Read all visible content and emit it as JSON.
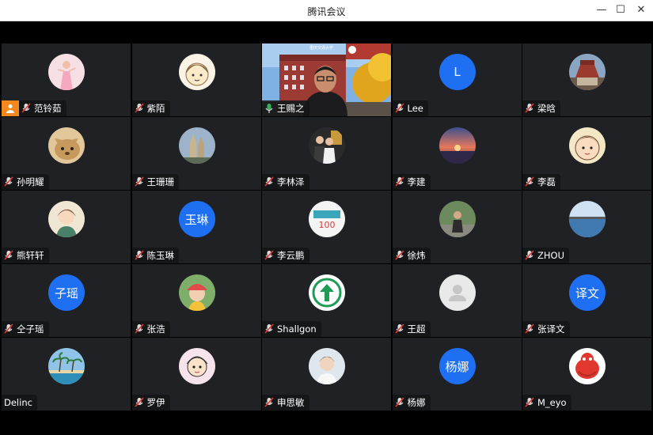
{
  "window": {
    "title": "腾讯会议",
    "controls": [
      "—",
      "☐",
      "✕"
    ]
  },
  "video_tile": {
    "banner_text": "重庆交通大学"
  },
  "participants": [
    {
      "name": "范铃茹",
      "avatar": "photo-girl-pink",
      "mic": "muted"
    },
    {
      "name": "紫陌",
      "avatar": "cartoon-girl",
      "mic": "muted"
    },
    {
      "name": "王赐之",
      "avatar": "live-video",
      "mic": "speaking"
    },
    {
      "name": "Lee",
      "avatar_text": "L",
      "mic": "muted"
    },
    {
      "name": "梁晗",
      "avatar": "photo-building",
      "mic": "muted"
    },
    {
      "name": "孙明耀",
      "avatar": "photo-animal",
      "mic": "muted"
    },
    {
      "name": "王珊珊",
      "avatar": "photo-cathedral",
      "mic": "muted"
    },
    {
      "name": "李林泽",
      "avatar": "photo-group",
      "mic": "muted"
    },
    {
      "name": "李建",
      "avatar": "photo-sunset",
      "mic": "muted"
    },
    {
      "name": "李磊",
      "avatar": "cartoon-face",
      "mic": "muted"
    },
    {
      "name": "熊轩轩",
      "avatar": "drawing-girl",
      "mic": "muted"
    },
    {
      "name": "陈玉琳",
      "avatar_text": "玉琳",
      "mic": "muted"
    },
    {
      "name": "李云鹏",
      "avatar": "logo-100",
      "mic": "muted"
    },
    {
      "name": "徐炜",
      "avatar": "photo-person",
      "mic": "muted"
    },
    {
      "name": "ZHOU",
      "avatar": "photo-lake",
      "mic": "muted"
    },
    {
      "name": "仝子瑶",
      "avatar_text": "子瑶",
      "mic": "muted"
    },
    {
      "name": "张浩",
      "avatar": "photo-kid",
      "mic": "muted"
    },
    {
      "name": "Shallgon",
      "avatar": "arrow-up-logo",
      "mic": "muted"
    },
    {
      "name": "王超",
      "avatar": "default-person",
      "mic": "muted"
    },
    {
      "name": "张译文",
      "avatar_text": "译文",
      "mic": "muted"
    },
    {
      "name": "Delinc",
      "avatar": "photo-palms",
      "mic": "none"
    },
    {
      "name": "罗伊",
      "avatar": "cartoon-kid",
      "mic": "muted"
    },
    {
      "name": "申思敏",
      "avatar": "photo-boy",
      "mic": "muted"
    },
    {
      "name": "杨娜",
      "avatar_text": "杨娜",
      "mic": "muted"
    },
    {
      "name": "M_eyo",
      "avatar": "red-mascot",
      "mic": "muted"
    }
  ],
  "colors": {
    "tile_bg": "#202124",
    "avatar_blue": "#1e6ff1",
    "mic_muted": "#e53935",
    "mic_speaking": "#2fb35e",
    "active_border": "#2fb35e",
    "badge_orange": "#f5871f"
  }
}
